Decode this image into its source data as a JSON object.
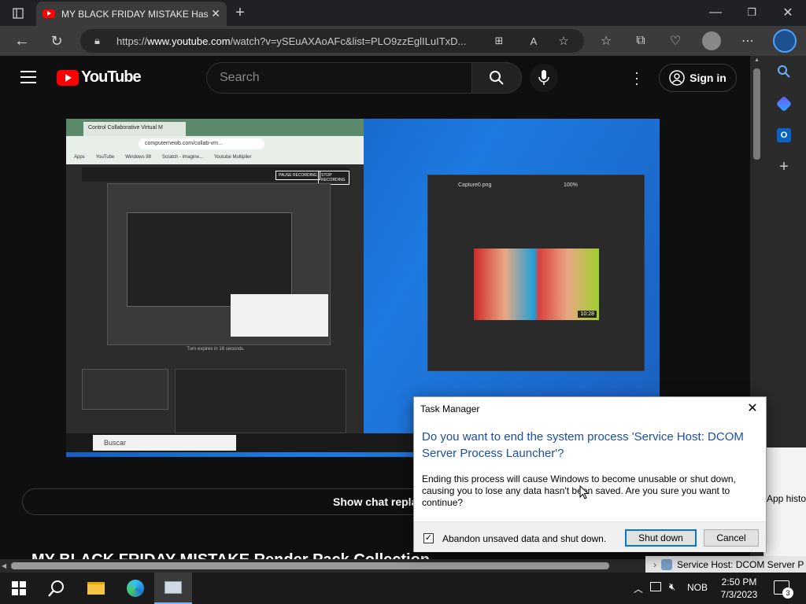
{
  "browser": {
    "tab_title": "MY BLACK FRIDAY MISTAKE Has",
    "url_prefix": "https://",
    "url_host": "www.youtube.com",
    "url_path": "/watch?v=ySEuAXAoAFc&list=PLO9zzEglILuITxD..."
  },
  "youtube": {
    "logo_text": "YouTube",
    "search_placeholder": "Search",
    "signin_label": "Sign in",
    "show_chat_replay": "Show chat replay",
    "video_title": "MY BLACK FRIDAY MISTAKE Render Pack Collection"
  },
  "task_manager_back": {
    "app_history_tab": "App histor",
    "service_row": "Service Host: DCOM Server P"
  },
  "dialog": {
    "title": "Task Manager",
    "heading": "Do you want to end the system process 'Service Host: DCOM Server Process Launcher'?",
    "body": "Ending this process will cause Windows to become unusable or shut down, causing you to lose any data hasn't been saved. Are you sure you want to continue?",
    "checkbox_label": "Abandon unsaved data and shut down.",
    "checkbox_checked": true,
    "shutdown_label": "Shut down",
    "cancel_label": "Cancel"
  },
  "taskbar": {
    "language": "NOB",
    "time": "2:50 PM",
    "date": "7/3/2023",
    "notification_count": "3"
  },
  "embedded_video": {
    "photo_window_title": "Capture0.png",
    "zoom": "100%",
    "thumb_duration": "10:28",
    "inner_search": "Buscar",
    "inner_tab": "Control Collaborative Virtual M",
    "inner_url": "computernewb.com/collab-vm...",
    "inner_bookmarks": [
      "Apps",
      "YouTube",
      "Windows 98",
      "Scratch - Imagine...",
      "Youtube Multiplier"
    ],
    "inner_buttons": [
      "PAUSE RECORDING",
      "STOP RECORDING"
    ],
    "inner_turn_text": "Turn expires in 16 seconds."
  }
}
